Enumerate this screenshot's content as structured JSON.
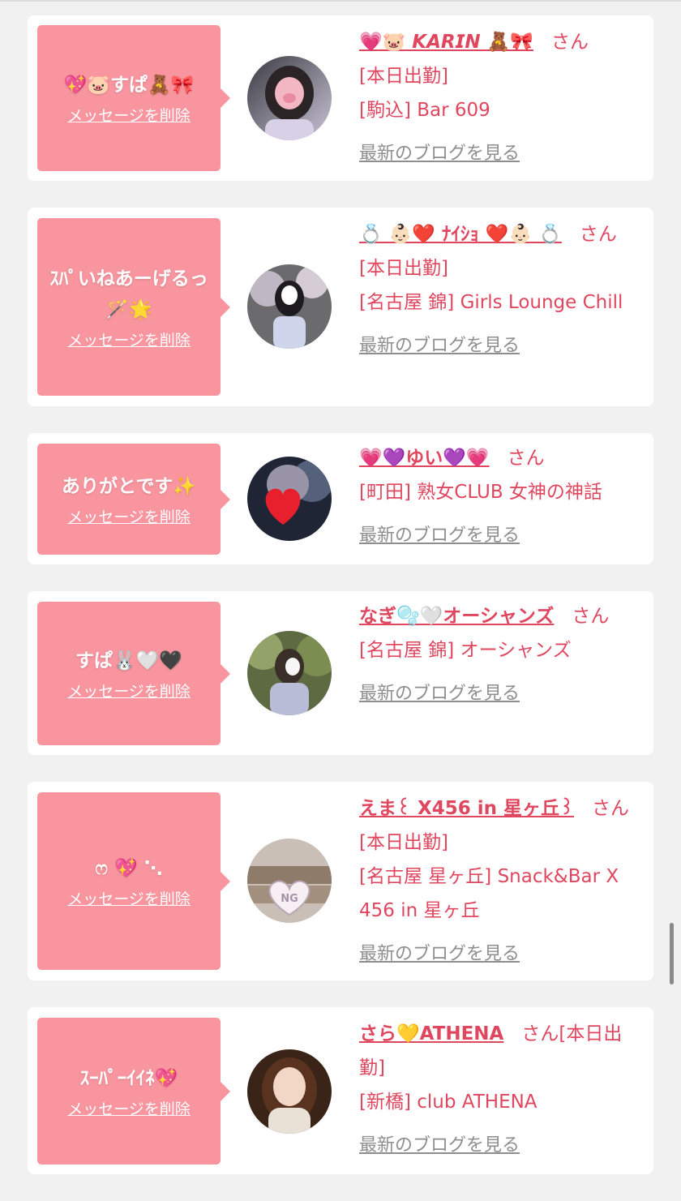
{
  "colors": {
    "page_bg": "#f1f1f1",
    "card_bg": "#ffffff",
    "bubble_bg": "#f8959f",
    "accent_text": "#e0475f",
    "link_gray": "#8e8e8e"
  },
  "delete_label": "メッセージを削除",
  "blog_label": "最新のブログを見る",
  "cards": [
    {
      "message": "💖🐷すぱ🧸🎀",
      "avatar_icon": "heart-icon",
      "cast_name": "💗🐷 𝙆𝘼𝙍𝙄𝙉 🧸🎀",
      "honorific": "さん",
      "status": "[本日出勤]",
      "shop": "[駒込] Bar 609"
    },
    {
      "message": "ｽﾊﾟいねあーげるっ🪄🌟",
      "avatar_icon": "person-icon",
      "cast_name": "💍 👶🏻❤️ ﾅｲｼｮ ❤️👶🏻 💍",
      "honorific": "さん",
      "status": "[本日出勤]",
      "shop": "[名古屋 錦] Girls Lounge Chill"
    },
    {
      "message": "ありがとです✨",
      "avatar_icon": "heart-icon",
      "cast_name": "💗💜ゆい💜💗",
      "honorific": "さん",
      "status": "",
      "shop": "[町田] 熟女CLUB 女神の神話"
    },
    {
      "message": "すぱ🐰🤍🖤",
      "avatar_icon": "person-icon",
      "cast_name": "なぎ🫧🤍オーシャンズ",
      "honorific": "さん",
      "status": "",
      "shop": "[名古屋 錦] オーシャンズ"
    },
    {
      "message": "ෆ 💖 ⋱",
      "avatar_icon": "ng-heart-icon",
      "cast_name": "えま꒰ X456 in 星ヶ丘꒱",
      "honorific": "さん",
      "status": "[本日出勤]",
      "shop": "[名古屋 星ヶ丘] Snack&Bar X 456 in 星ヶ丘"
    },
    {
      "message": "ｽｰﾊﾟｰｲｲﾈ💖",
      "avatar_icon": "person-icon",
      "cast_name": "さら💛ATHENA",
      "honorific": "さん",
      "status": "[本日出勤]",
      "shop": "[新橋] club ATHENA"
    }
  ]
}
